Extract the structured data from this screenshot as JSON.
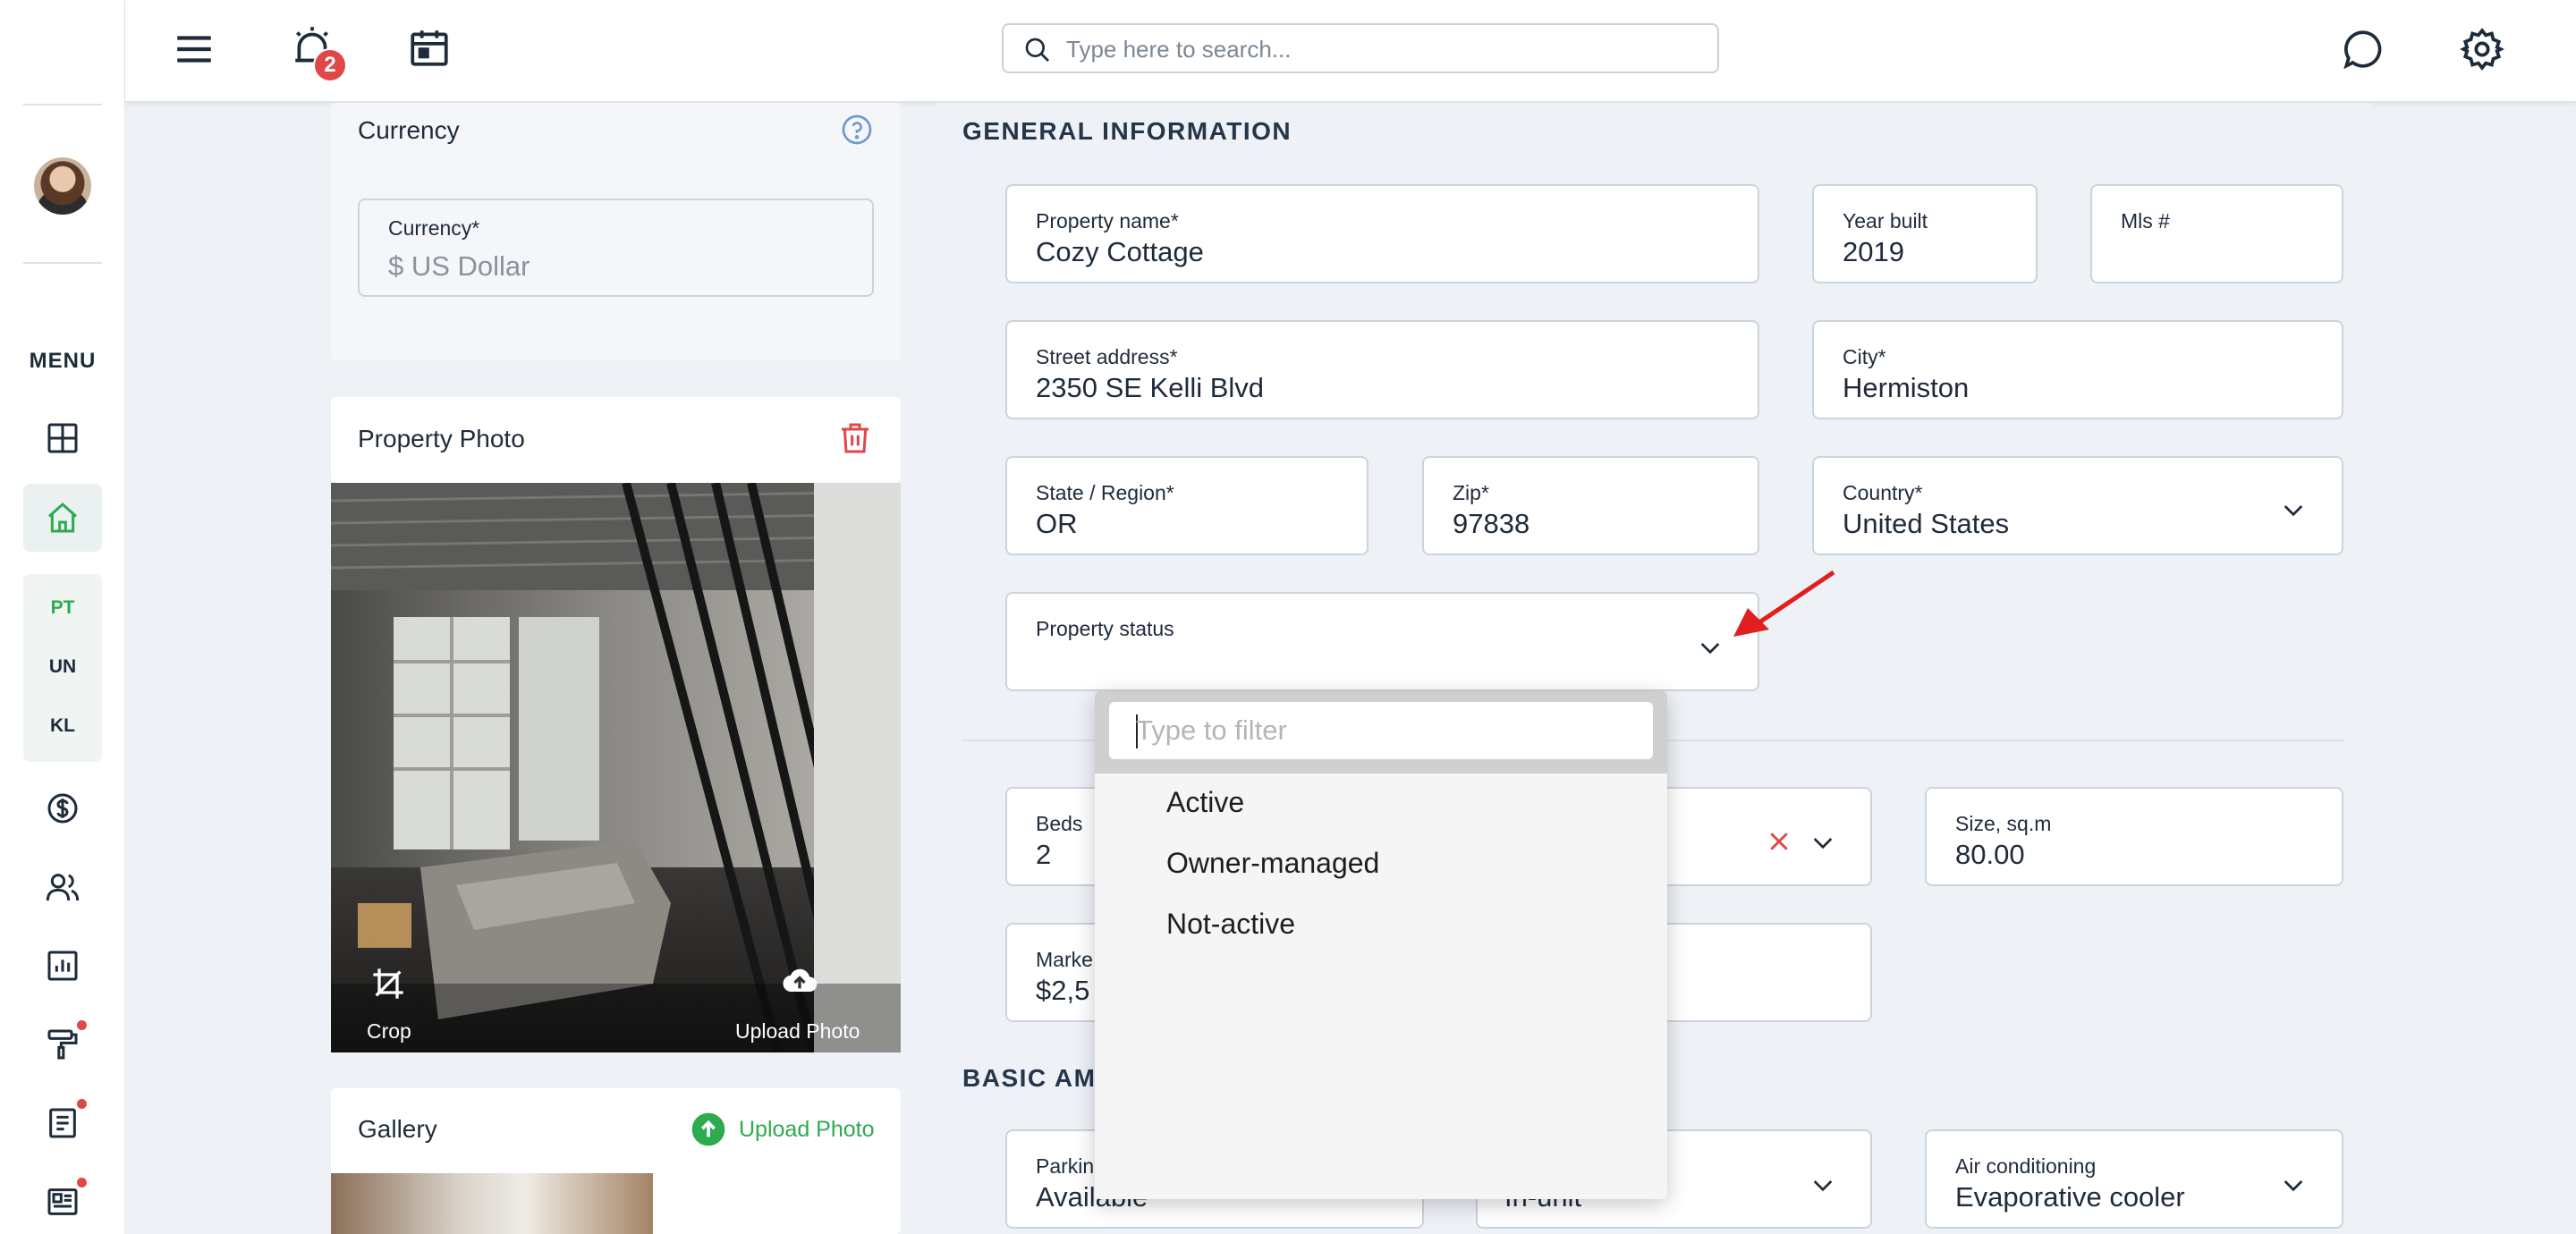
{
  "sidebar": {
    "menu_label": "MENU",
    "items": [
      {
        "name": "dashboard",
        "icon": "dashboard-icon"
      },
      {
        "name": "properties",
        "icon": "home-icon",
        "active": true
      },
      {
        "name": "finance",
        "icon": "dollar-icon"
      },
      {
        "name": "people",
        "icon": "users-icon"
      },
      {
        "name": "reports",
        "icon": "chart-icon"
      },
      {
        "name": "maintenance",
        "icon": "paint-roller-icon",
        "dot": true
      },
      {
        "name": "documents",
        "icon": "document-icon",
        "dot": true
      },
      {
        "name": "news",
        "icon": "newspaper-icon",
        "dot": true
      }
    ],
    "shortcuts": [
      "PT",
      "UN",
      "KL"
    ]
  },
  "topbar": {
    "notification_count": "2",
    "search_placeholder": "Type here to search..."
  },
  "currency_card": {
    "title": "Currency",
    "field_label": "Currency*",
    "field_value": "$ US Dollar"
  },
  "photo_card": {
    "title": "Property Photo",
    "crop_label": "Crop",
    "upload_label": "Upload Photo"
  },
  "gallery_card": {
    "title": "Gallery",
    "upload_label": "Upload Photo"
  },
  "general": {
    "section_title": "GENERAL INFORMATION",
    "property_name": {
      "label": "Property name*",
      "value": "Cozy Cottage"
    },
    "year_built": {
      "label": "Year built",
      "value": "2019"
    },
    "mls": {
      "label": "Mls #",
      "value": ""
    },
    "street": {
      "label": "Street address*",
      "value": "2350 SE Kelli Blvd"
    },
    "city": {
      "label": "City*",
      "value": "Hermiston"
    },
    "state": {
      "label": "State / Region*",
      "value": "OR"
    },
    "zip": {
      "label": "Zip*",
      "value": "97838"
    },
    "country": {
      "label": "Country*",
      "value": "United States"
    },
    "status": {
      "label": "Property status",
      "value": ""
    }
  },
  "details": {
    "beds": {
      "label": "Beds",
      "value": "2"
    },
    "size": {
      "label": "Size, sq.m",
      "value": "80.00"
    },
    "market": {
      "label": "Marke",
      "value": "$2,5"
    }
  },
  "amenities": {
    "section_title": "BASIC AME",
    "parking": {
      "label": "Parkin",
      "value": "Available"
    },
    "laundry": {
      "value": "In-unit"
    },
    "air": {
      "label": "Air conditioning",
      "value": "Evaporative cooler"
    }
  },
  "status_dropdown": {
    "filter_placeholder": "Type to filter",
    "options": [
      "Active",
      "Owner-managed",
      "Not-active"
    ]
  },
  "colors": {
    "accent_green": "#2eaa4f",
    "danger_red": "#e04848",
    "annotation_arrow": "#e02020"
  }
}
